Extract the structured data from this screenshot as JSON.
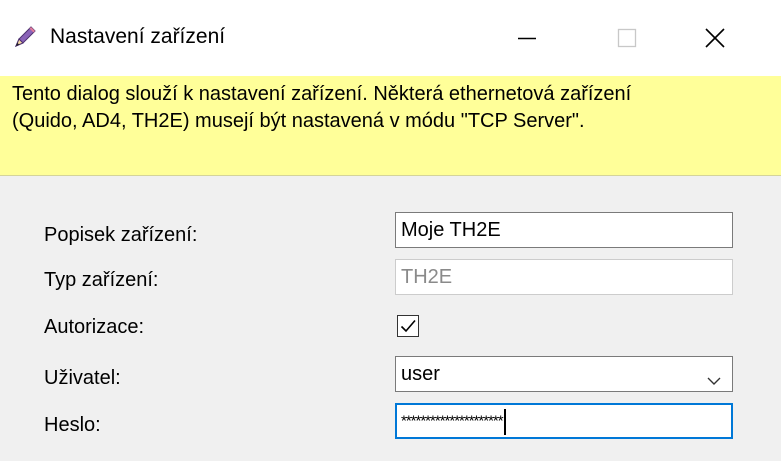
{
  "window": {
    "title": "Nastavení zařízení",
    "icon": "pencil-icon",
    "controls": [
      "minimize-icon",
      "maximize-icon",
      "close-icon"
    ]
  },
  "banner": {
    "text": "Tento dialog slouží k nastavení zařízení. Některá ethernetová zařízení\n(Quido, AD4, TH2E) musejí být nastavená v módu \"TCP Server\".",
    "background": "#ffff99"
  },
  "form": {
    "device_label": {
      "label": "Popisek zařízení:",
      "value": "Moje TH2E"
    },
    "device_type": {
      "label": "Typ zařízení:",
      "value": "TH2E",
      "disabled": true
    },
    "authorization": {
      "label": "Autorizace:",
      "checked": true
    },
    "user": {
      "label": "Uživatel:",
      "value": "user"
    },
    "password": {
      "label": "Heslo:",
      "value": "*********************"
    }
  },
  "colors": {
    "focus": "#0078d7",
    "accent_icon": "#7b4fa0"
  }
}
